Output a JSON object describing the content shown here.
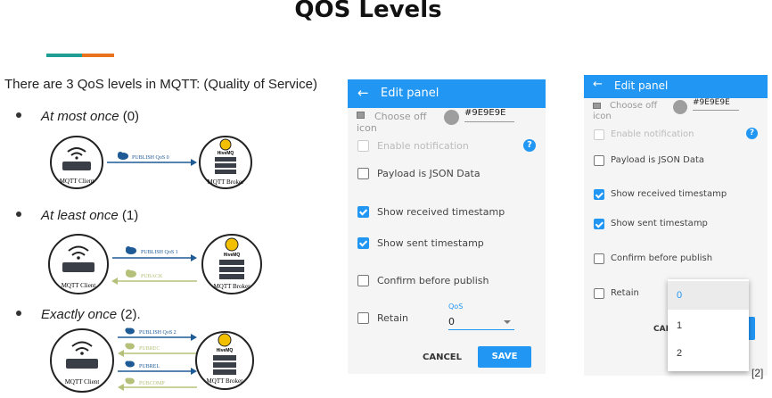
{
  "slide": {
    "title": "QOS Levels",
    "intro": "There are 3 QoS levels in MQTT: (Quality of Service)",
    "bullets": [
      {
        "term": "At most once",
        "value": " (0)"
      },
      {
        "term": "At least once",
        "value": " (1)"
      },
      {
        "term": "Exactly once",
        "value": " (2)."
      }
    ],
    "reference": "[2]",
    "accent_colors": {
      "teal": "#1f9e95",
      "orange": "#e8731c"
    }
  },
  "diagrams": {
    "client_label": "MQTT Client",
    "broker_label": "MQTT Broker",
    "hivemq": "HiveMQ",
    "qos0": [
      "PUBLISH QoS 0"
    ],
    "qos1": [
      "PUBLISH QoS 1",
      "PUBACK"
    ],
    "qos2": [
      "PUBLISH QoS 2",
      "PUBREC",
      "PUBREL",
      "PUBCOMP"
    ]
  },
  "panel_left": {
    "title": "Edit panel",
    "choose_icon": "Choose off icon",
    "color_value": "#9E9E9E",
    "enable_notification": "Enable notification",
    "payload_json": "Payload is JSON Data",
    "show_received": "Show received timestamp",
    "show_sent": "Show sent timestamp",
    "confirm_publish": "Confirm before publish",
    "retain": "Retain",
    "qos_label": "QoS",
    "qos_value": "0",
    "cancel": "CANCEL",
    "save": "SAVE"
  },
  "panel_right": {
    "title": "Edit panel",
    "choose_icon": "Choose off icon",
    "color_value": "#9E9E9E",
    "enable_notification": "Enable notification",
    "payload_json": "Payload is JSON Data",
    "show_received": "Show received timestamp",
    "show_sent": "Show sent timestamp",
    "confirm_publish": "Confirm before publish",
    "retain": "Retain",
    "cancel_partial": "CAN",
    "dropdown_options": [
      "0",
      "1",
      "2"
    ],
    "selected_option": "0"
  },
  "colors": {
    "primary": "#2196f3",
    "message_publish": "#1e5a96",
    "message_ack": "#b5c07a"
  }
}
